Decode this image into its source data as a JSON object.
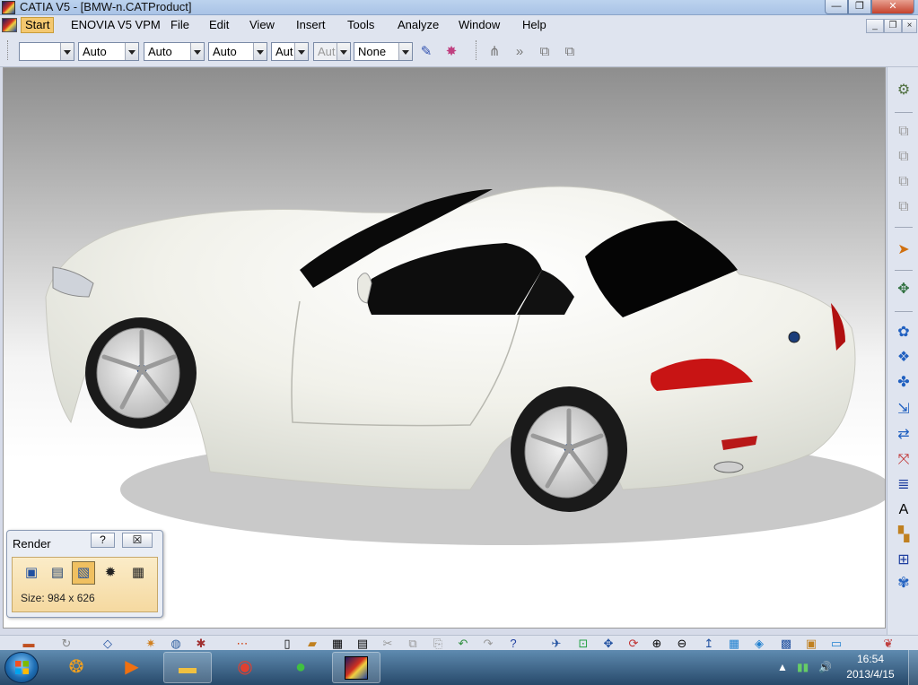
{
  "window": {
    "title": "CATIA V5 - [BMW-n.CATProduct]",
    "min_glyph": "—",
    "max_glyph": "❐",
    "close_glyph": "✕"
  },
  "menu": {
    "items": [
      "Start",
      "ENOVIA V5 VPM",
      "File",
      "Edit",
      "View",
      "Insert",
      "Tools",
      "Analyze",
      "Window",
      "Help"
    ],
    "active": "Start"
  },
  "mdi": {
    "min_glyph": "_",
    "restore_glyph": "❐",
    "close_glyph": "×"
  },
  "toolbar": {
    "color_combo": "",
    "combos": [
      "Auto",
      "Auto",
      "Auto",
      "Aut",
      "Aut",
      "None"
    ],
    "disabled_combo_index": 4
  },
  "render_panel": {
    "title": "Render",
    "help_glyph": "?",
    "close_glyph": "☒",
    "size_text": "Size: 984 x 626",
    "buttons": [
      "render-to-viewport-icon",
      "render-settings-icon",
      "render-area-icon",
      "camera-flash-icon",
      "save-icon"
    ],
    "pressed_index": 2
  },
  "taskbar": {
    "time": "16:54",
    "date": "2013/4/15",
    "apps": [
      "library-icon",
      "media-player-icon",
      "file-explorer-icon",
      "chrome-icon",
      "color-ball-icon",
      "catia-icon"
    ]
  },
  "colors": {
    "car_body": "#f1f1ea",
    "glass": "#0a0a0a",
    "tail_light": "#c81414",
    "tire": "#1a1a1a",
    "rim": "#dcdcdc"
  }
}
